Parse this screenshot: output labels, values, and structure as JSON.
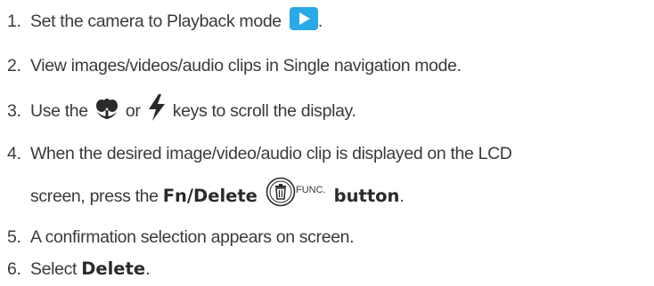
{
  "steps": [
    {
      "num": "1.",
      "text": "Set the camera to Playback mode",
      "after": "."
    },
    {
      "num": "2.",
      "text": "View images/videos/audio clips in Single navigation mode."
    },
    {
      "num": "3.",
      "pre": "Use the",
      "mid": "or",
      "post": "keys to scroll the display."
    },
    {
      "num": "4.",
      "line1": "When the desired image/video/audio clip is displayed on the LCD",
      "line2_pre": "screen, press the",
      "bold1": "Fn/Delete",
      "func": "FUNC.",
      "bold2": "button",
      "after": "."
    },
    {
      "num": "5.",
      "text": "A confirmation selection appears on screen."
    },
    {
      "num": "6.",
      "pre": "Select",
      "bold": "Delete",
      "after": "."
    }
  ],
  "icons": {
    "playback": "playback-icon",
    "macro": "macro-flower-icon",
    "flash": "flash-bolt-icon",
    "delete": "trash-delete-icon"
  },
  "colors": {
    "text": "#3a3a3a",
    "playback_icon_bg": "#29a9e6"
  }
}
